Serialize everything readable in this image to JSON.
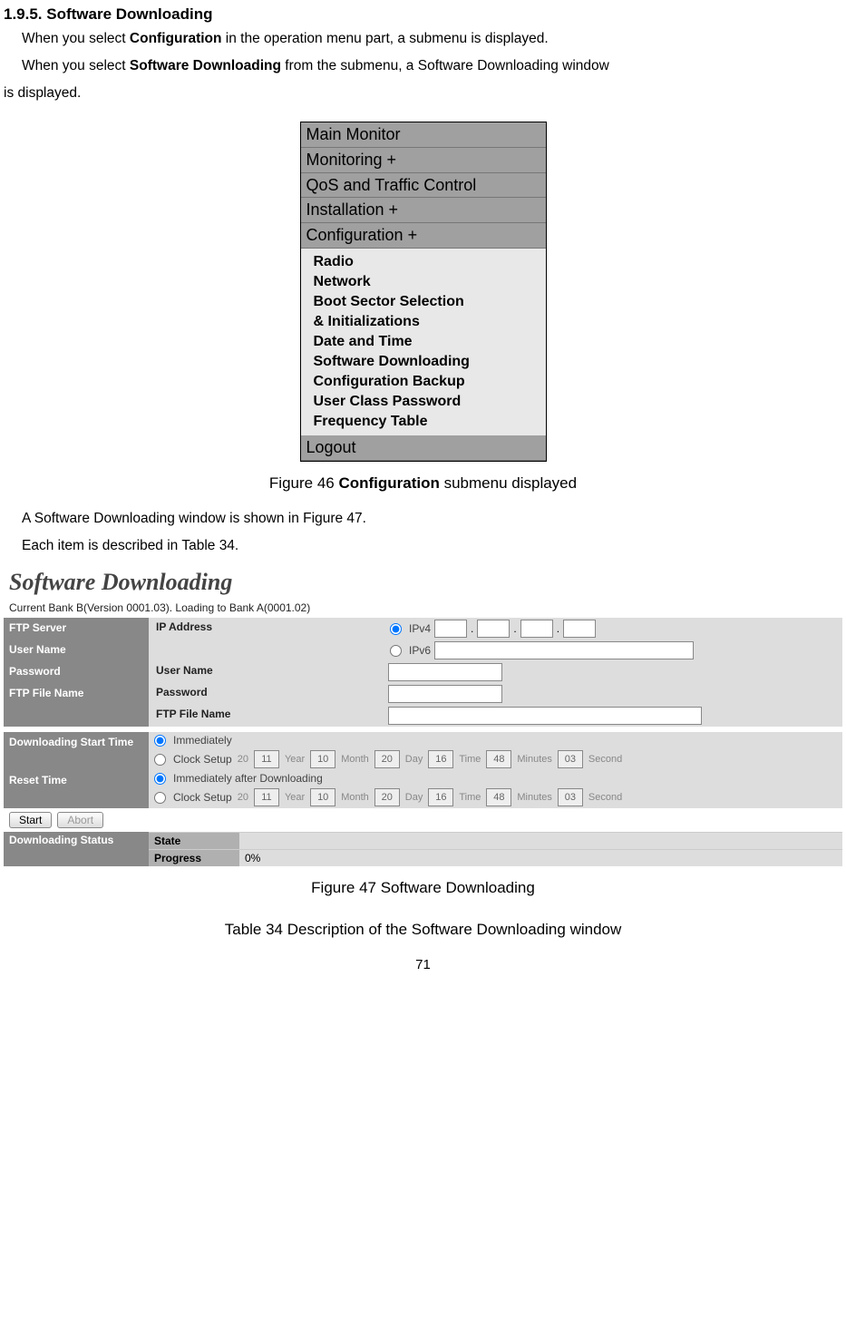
{
  "heading": "1.9.5. Software Downloading",
  "para1_pre": "When you select ",
  "para1_bold": "Configuration",
  "para1_post": " in the operation menu part, a submenu is displayed.",
  "para2_pre": "When you select ",
  "para2_bold": "Software Downloading",
  "para2_post": " from the submenu, a Software Downloading window",
  "para2_line2": "is displayed.",
  "menu": {
    "main_monitor": "Main Monitor",
    "monitoring": "Monitoring +",
    "qos": "QoS and Traffic Control",
    "installation": "Installation +",
    "configuration": "Configuration +",
    "sub": {
      "radio": "Radio",
      "network": "Network",
      "boot1": "Boot Sector Selection",
      "boot2": "& Initializations",
      "date": "Date and Time",
      "swdl": "Software Downloading",
      "backup": "Configuration Backup",
      "user": "User Class Password",
      "freq": "Frequency Table"
    },
    "logout": "Logout"
  },
  "fig46_pre": "Figure 46 ",
  "fig46_bold": "Configuration",
  "fig46_post": " submenu displayed",
  "mid1": "A Software Downloading window is shown in Figure 47.",
  "mid2": "Each item is described in Table 34.",
  "sw": {
    "title": "Software Downloading",
    "bank": "Current Bank B(Version 0001.03). Loading to Bank A(0001.02)",
    "labels": {
      "ftp_server": "FTP Server",
      "user_name": "User Name",
      "password": "Password",
      "ftp_file": "FTP File Name",
      "ip_address": "IP Address",
      "dl_start": "Downloading Start Time",
      "reset_time": "Reset Time",
      "dl_status": "Downloading Status",
      "state": "State",
      "progress": "Progress"
    },
    "radios": {
      "ipv4": "IPv4",
      "ipv6": "IPv6",
      "immediately": "Immediately",
      "clock_setup": "Clock Setup",
      "imm_after": "Immediately after Downloading"
    },
    "dt": {
      "year": "Year",
      "month": "Month",
      "day": "Day",
      "time": "Time",
      "minutes": "Minutes",
      "second": "Second",
      "pre20": "20",
      "yr": "11",
      "mo": "10",
      "dy": "20",
      "hr": "16",
      "mn": "48",
      "sc": "03"
    },
    "buttons": {
      "start": "Start",
      "abort": "Abort"
    },
    "progress_val": "0%"
  },
  "fig47": "Figure 47 Software Downloading",
  "table34": "Table 34 Description of the Software Downloading window",
  "page": "71"
}
